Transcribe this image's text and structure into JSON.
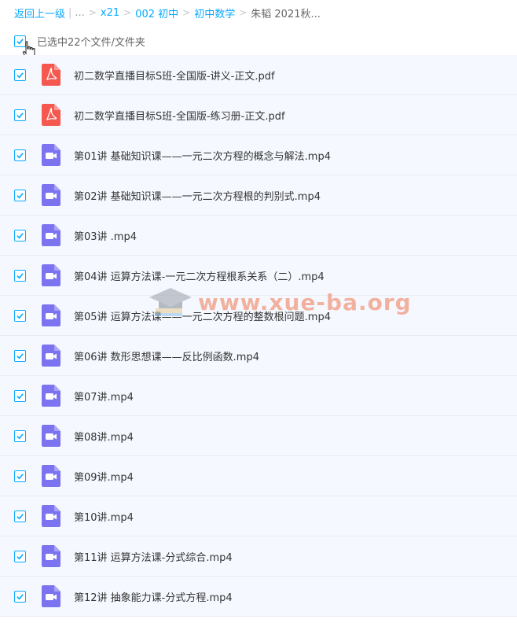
{
  "breadcrumb": {
    "back": "返回上一级",
    "ellipsis": "...",
    "items": [
      "x21",
      "002 初中",
      "初中数学"
    ],
    "current": "朱韬 2021秋..."
  },
  "selection": {
    "label": "已选中22个文件/文件夹"
  },
  "files": [
    {
      "name": "初二数学直播目标S班-全国版-讲义-正文.pdf",
      "type": "pdf"
    },
    {
      "name": "初二数学直播目标S班-全国版-练习册-正文.pdf",
      "type": "pdf"
    },
    {
      "name": "第01讲 基础知识课——一元二次方程的概念与解法.mp4",
      "type": "video"
    },
    {
      "name": "第02讲 基础知识课——一元二次方程根的判别式.mp4",
      "type": "video"
    },
    {
      "name": "第03讲 .mp4",
      "type": "video"
    },
    {
      "name": "第04讲 运算方法课-一元二次方程根系关系（二）.mp4",
      "type": "video"
    },
    {
      "name": "第05讲 运算方法课——一元二次方程的整数根问题.mp4",
      "type": "video"
    },
    {
      "name": "第06讲 数形思想课——反比例函数.mp4",
      "type": "video"
    },
    {
      "name": "第07讲.mp4",
      "type": "video"
    },
    {
      "name": "第08讲.mp4",
      "type": "video"
    },
    {
      "name": "第09讲.mp4",
      "type": "video"
    },
    {
      "name": "第10讲.mp4",
      "type": "video"
    },
    {
      "name": "第11讲 运算方法课-分式综合.mp4",
      "type": "video"
    },
    {
      "name": "第12讲 抽象能力课-分式方程.mp4",
      "type": "video"
    }
  ],
  "watermark": "www.xue-ba.org",
  "colors": {
    "accent": "#09aaff",
    "pdf": "#f4584f",
    "video": "#7b73f0"
  }
}
